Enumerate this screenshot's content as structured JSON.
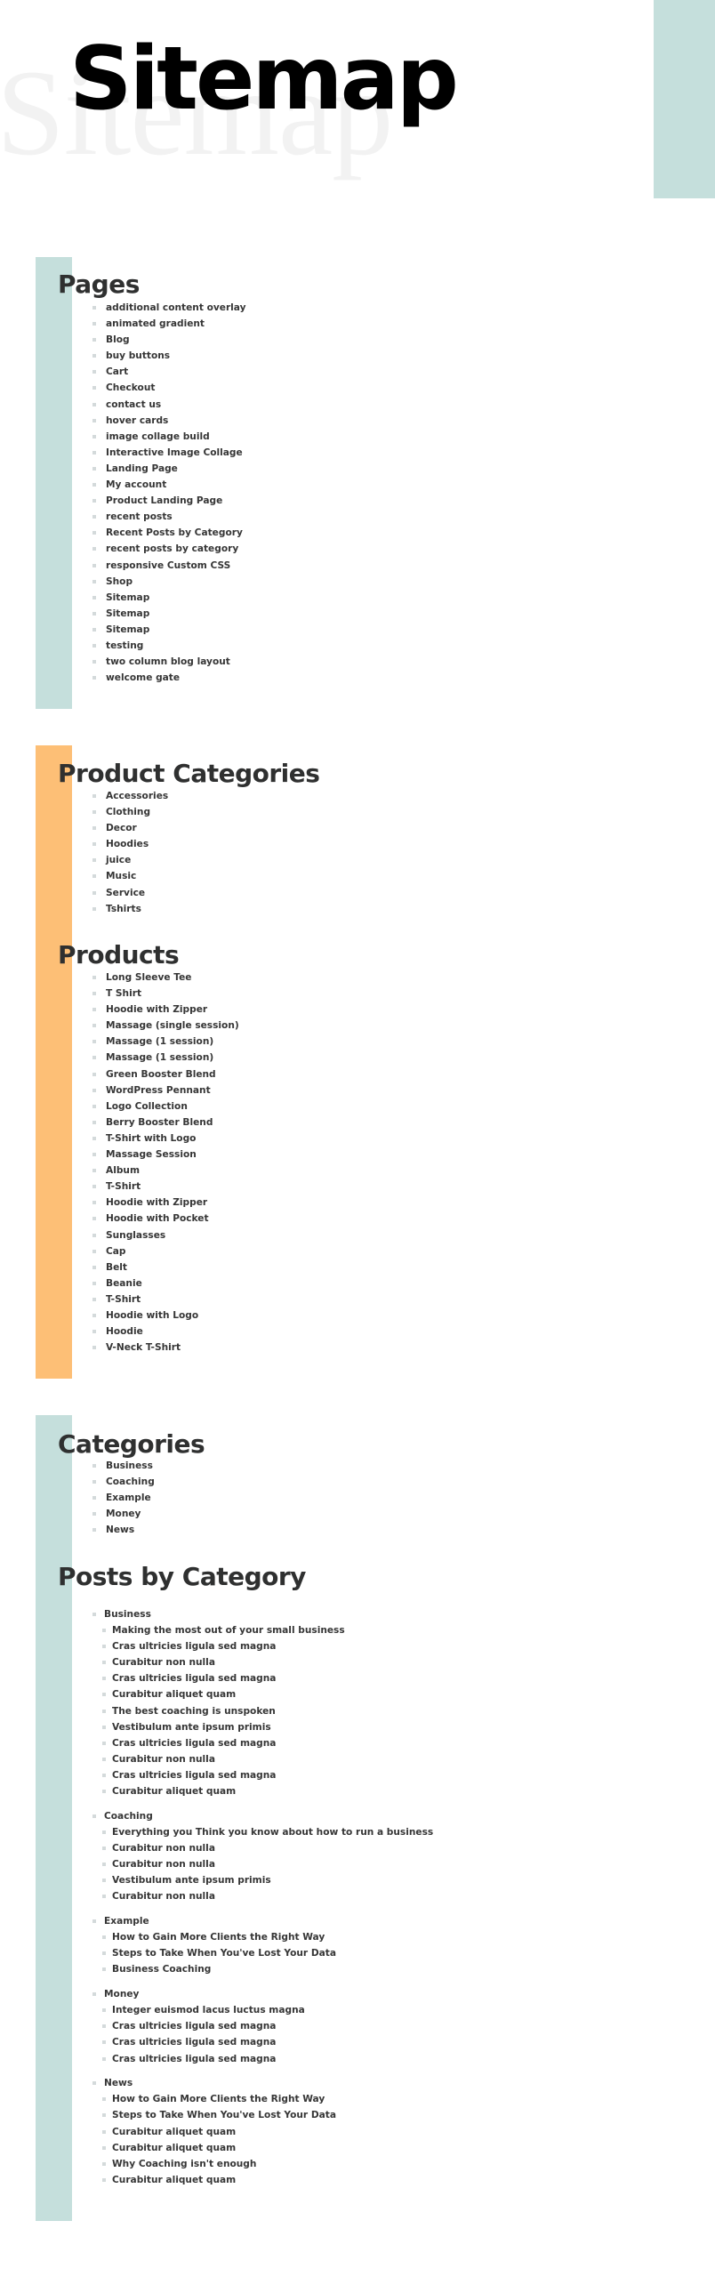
{
  "header": {
    "title": "Sitemap",
    "ghost_title": "Sitemap"
  },
  "colors": {
    "teal_accent": "#c5dfdc",
    "orange_accent": "#fdbf76",
    "heading": "#2f3030",
    "text": "#363636",
    "bullet": "#d4dadb"
  },
  "pages": {
    "heading": "Pages",
    "items": [
      "additional content overlay",
      "animated gradient",
      "Blog",
      "buy buttons",
      "Cart",
      "Checkout",
      "contact us",
      "hover cards",
      "image collage build",
      "Interactive Image Collage",
      "Landing Page",
      "My account",
      "Product Landing Page",
      "recent posts",
      "Recent Posts by Category",
      "recent posts by category",
      "responsive Custom CSS",
      "Shop",
      "Sitemap",
      "Sitemap",
      "Sitemap",
      "testing",
      "two column blog layout",
      "welcome gate"
    ]
  },
  "product_categories": {
    "heading": "Product Categories",
    "items": [
      "Accessories",
      "Clothing",
      "Decor",
      "Hoodies",
      "juice",
      "Music",
      "Service",
      "Tshirts"
    ]
  },
  "products": {
    "heading": "Products",
    "items": [
      "Long Sleeve Tee",
      "T Shirt",
      "Hoodie with Zipper",
      "Massage (single session)",
      "Massage (1 session)",
      "Massage (1 session)",
      "Green Booster Blend",
      "WordPress Pennant",
      "Logo Collection",
      "Berry Booster Blend",
      "T-Shirt with Logo",
      "Massage Session",
      "Album",
      "T-Shirt",
      "Hoodie with Zipper",
      "Hoodie with Pocket",
      "Sunglasses",
      "Cap",
      "Belt",
      "Beanie",
      "T-Shirt",
      "Hoodie with Logo",
      "Hoodie",
      "V-Neck T-Shirt"
    ]
  },
  "categories": {
    "heading": "Categories",
    "items": [
      "Business",
      "Coaching",
      "Example",
      "Money",
      "News"
    ]
  },
  "posts_by_category": {
    "heading": "Posts by Category",
    "groups": [
      {
        "name": "Business",
        "posts": [
          "Making the most out of your small business",
          "Cras ultricies ligula sed magna",
          "Curabitur non nulla",
          "Cras ultricies ligula sed magna",
          "Curabitur aliquet quam",
          "The best coaching is unspoken",
          "Vestibulum ante ipsum primis",
          "Cras ultricies ligula sed magna",
          "Curabitur non nulla",
          "Cras ultricies ligula sed magna",
          "Curabitur aliquet quam"
        ]
      },
      {
        "name": "Coaching",
        "posts": [
          "Everything you Think you know about how to run a business",
          "Curabitur non nulla",
          "Curabitur non nulla",
          "Vestibulum ante ipsum primis",
          "Curabitur non nulla"
        ]
      },
      {
        "name": "Example",
        "posts": [
          "How to Gain More Clients the Right Way",
          "Steps to Take When You've Lost Your Data",
          "Business Coaching"
        ]
      },
      {
        "name": "Money",
        "posts": [
          "Integer euismod lacus luctus magna",
          "Cras ultricies ligula sed magna",
          "Cras ultricies ligula sed magna",
          "Cras ultricies ligula sed magna"
        ]
      },
      {
        "name": "News",
        "posts": [
          "How to Gain More Clients the Right Way",
          "Steps to Take When You've Lost Your Data",
          "Curabitur aliquet quam",
          "Curabitur aliquet quam",
          "Why Coaching isn't enough",
          "Curabitur aliquet quam"
        ]
      }
    ]
  }
}
